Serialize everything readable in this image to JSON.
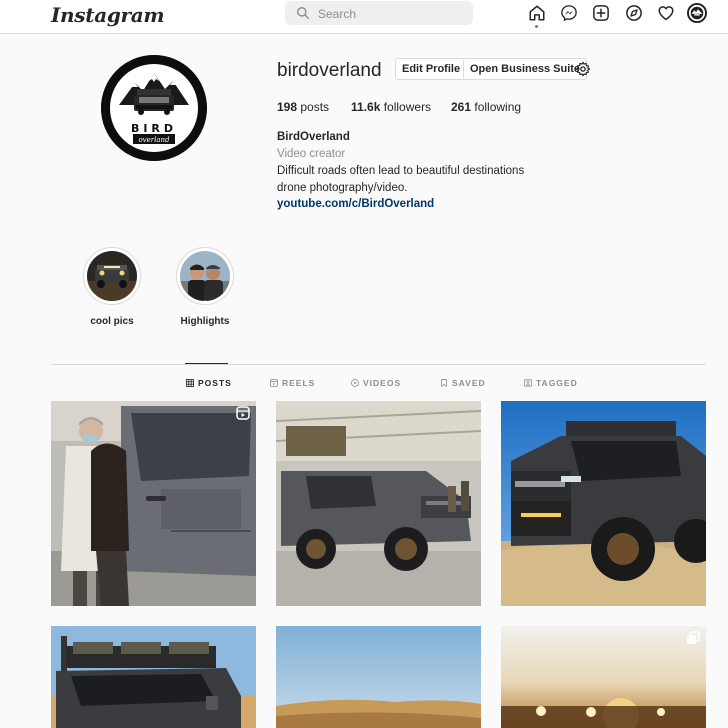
{
  "nav": {
    "logo": "Instagram",
    "search_placeholder": "Search",
    "icons": [
      "home-icon",
      "messenger-icon",
      "new-post-icon",
      "explore-icon",
      "activity-icon",
      "profile-avatar"
    ]
  },
  "profile": {
    "username": "birdoverland",
    "edit_profile_label": "Edit Profile",
    "business_suite_label": "Open Business Suite",
    "stats": {
      "posts_count": "198",
      "posts_label": " posts",
      "followers_count": "11.6k",
      "followers_label": " followers",
      "following_count": "261",
      "following_label": " following"
    },
    "bio": {
      "name": "BirdOverland",
      "category": "Video creator",
      "line1": "Difficult roads often lead to beautiful destinations",
      "line2": "drone photography/video.",
      "link": "youtube.com/c/BirdOverland"
    },
    "avatar_logo_text": "BIRD",
    "avatar_logo_script": "overland"
  },
  "highlights": [
    {
      "label": "cool pics"
    },
    {
      "label": "Highlights"
    }
  ],
  "tabs": [
    {
      "label": "POSTS",
      "icon": "grid-icon",
      "active": true
    },
    {
      "label": "REELS",
      "icon": "reels-icon",
      "active": false
    },
    {
      "label": "VIDEOS",
      "icon": "igtv-icon",
      "active": false
    },
    {
      "label": "SAVED",
      "icon": "bookmark-icon",
      "active": false
    },
    {
      "label": "TAGGED",
      "icon": "tagged-icon",
      "active": false
    }
  ],
  "colors": {
    "link": "#00376b",
    "notification": "#ed4956",
    "border": "#dbdbdb",
    "muted": "#8e8e8e"
  }
}
